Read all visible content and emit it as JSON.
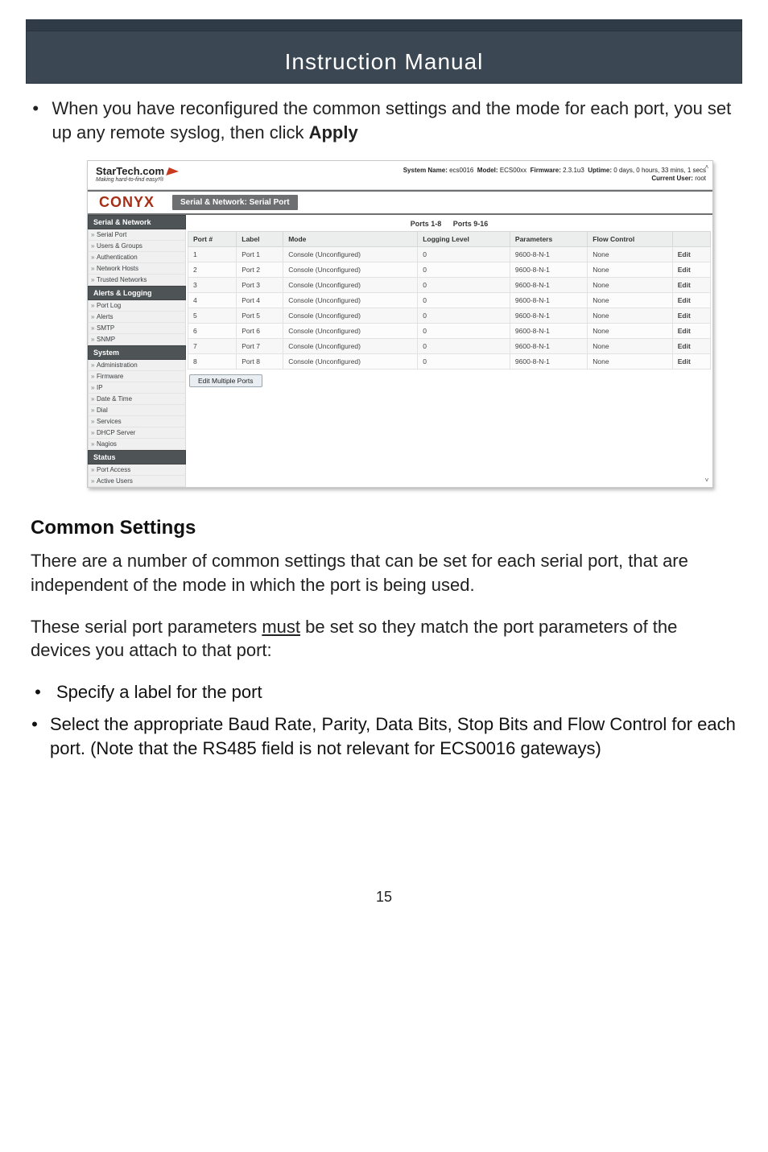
{
  "header_title": "Instruction Manual",
  "intro_bullet": "When you have reconfigured the common settings and the mode for each port, you set up any remote syslog, then click ",
  "intro_bold": "Apply",
  "screenshot": {
    "logo_text": "StarTech.com",
    "logo_sub": "Making hard-to-find easy!®",
    "sys": {
      "name_lbl": "System Name:",
      "name": "ecs0016",
      "model_lbl": "Model:",
      "model": "ECS00xx",
      "fw_lbl": "Firmware:",
      "fw": "2.3.1u3",
      "up_lbl": "Uptime:",
      "up": "0 days, 0 hours, 33 mins, 1 secs",
      "user_lbl": "Current User:",
      "user": "root"
    },
    "conyx": "CONYX",
    "section_title": "Serial & Network: Serial Port",
    "tabs": {
      "a": "Ports 1-8",
      "b": "Ports 9-16"
    },
    "columns": {
      "c1": "Port #",
      "c2": "Label",
      "c3": "Mode",
      "c4": "Logging Level",
      "c5": "Parameters",
      "c6": "Flow Control",
      "c7": ""
    },
    "rows": [
      {
        "n": "1",
        "label": "Port 1",
        "mode": "Console (Unconfigured)",
        "ll": "0",
        "params": "9600-8-N-1",
        "flow": "None",
        "edit": "Edit"
      },
      {
        "n": "2",
        "label": "Port 2",
        "mode": "Console (Unconfigured)",
        "ll": "0",
        "params": "9600-8-N-1",
        "flow": "None",
        "edit": "Edit"
      },
      {
        "n": "3",
        "label": "Port 3",
        "mode": "Console (Unconfigured)",
        "ll": "0",
        "params": "9600-8-N-1",
        "flow": "None",
        "edit": "Edit"
      },
      {
        "n": "4",
        "label": "Port 4",
        "mode": "Console (Unconfigured)",
        "ll": "0",
        "params": "9600-8-N-1",
        "flow": "None",
        "edit": "Edit"
      },
      {
        "n": "5",
        "label": "Port 5",
        "mode": "Console (Unconfigured)",
        "ll": "0",
        "params": "9600-8-N-1",
        "flow": "None",
        "edit": "Edit"
      },
      {
        "n": "6",
        "label": "Port 6",
        "mode": "Console (Unconfigured)",
        "ll": "0",
        "params": "9600-8-N-1",
        "flow": "None",
        "edit": "Edit"
      },
      {
        "n": "7",
        "label": "Port 7",
        "mode": "Console (Unconfigured)",
        "ll": "0",
        "params": "9600-8-N-1",
        "flow": "None",
        "edit": "Edit"
      },
      {
        "n": "8",
        "label": "Port 8",
        "mode": "Console (Unconfigured)",
        "ll": "0",
        "params": "9600-8-N-1",
        "flow": "None",
        "edit": "Edit"
      }
    ],
    "edit_multiple": "Edit Multiple Ports",
    "side_sections": {
      "s1": "Serial & Network",
      "s1_items": [
        "Serial Port",
        "Users & Groups",
        "Authentication",
        "Network Hosts",
        "Trusted Networks"
      ],
      "s2": "Alerts & Logging",
      "s2_items": [
        "Port Log",
        "Alerts",
        "SMTP",
        "SNMP"
      ],
      "s3": "System",
      "s3_items": [
        "Administration",
        "Firmware",
        "IP",
        "Date & Time",
        "Dial",
        "Services",
        "DHCP Server",
        "Nagios"
      ],
      "s4": "Status",
      "s4_items": [
        "Port Access",
        "Active Users"
      ]
    }
  },
  "section_heading": "Common Settings",
  "para1": "There are a number of common settings that can be set for each serial port, that are independent of the mode in which the port is being used.",
  "para2_a": "These serial port parameters ",
  "para2_u": "must",
  "para2_b": " be set so they match the port param­eters of the devices you attach to that port:",
  "bul1": "Specify a label for the port",
  "bul2": "Select the appropriate Baud Rate, Parity, Data Bits, Stop Bits and Flow Control for each port. (Note that the RS485 field is not relevant for ECS0016 gateways)",
  "page_number": "15"
}
